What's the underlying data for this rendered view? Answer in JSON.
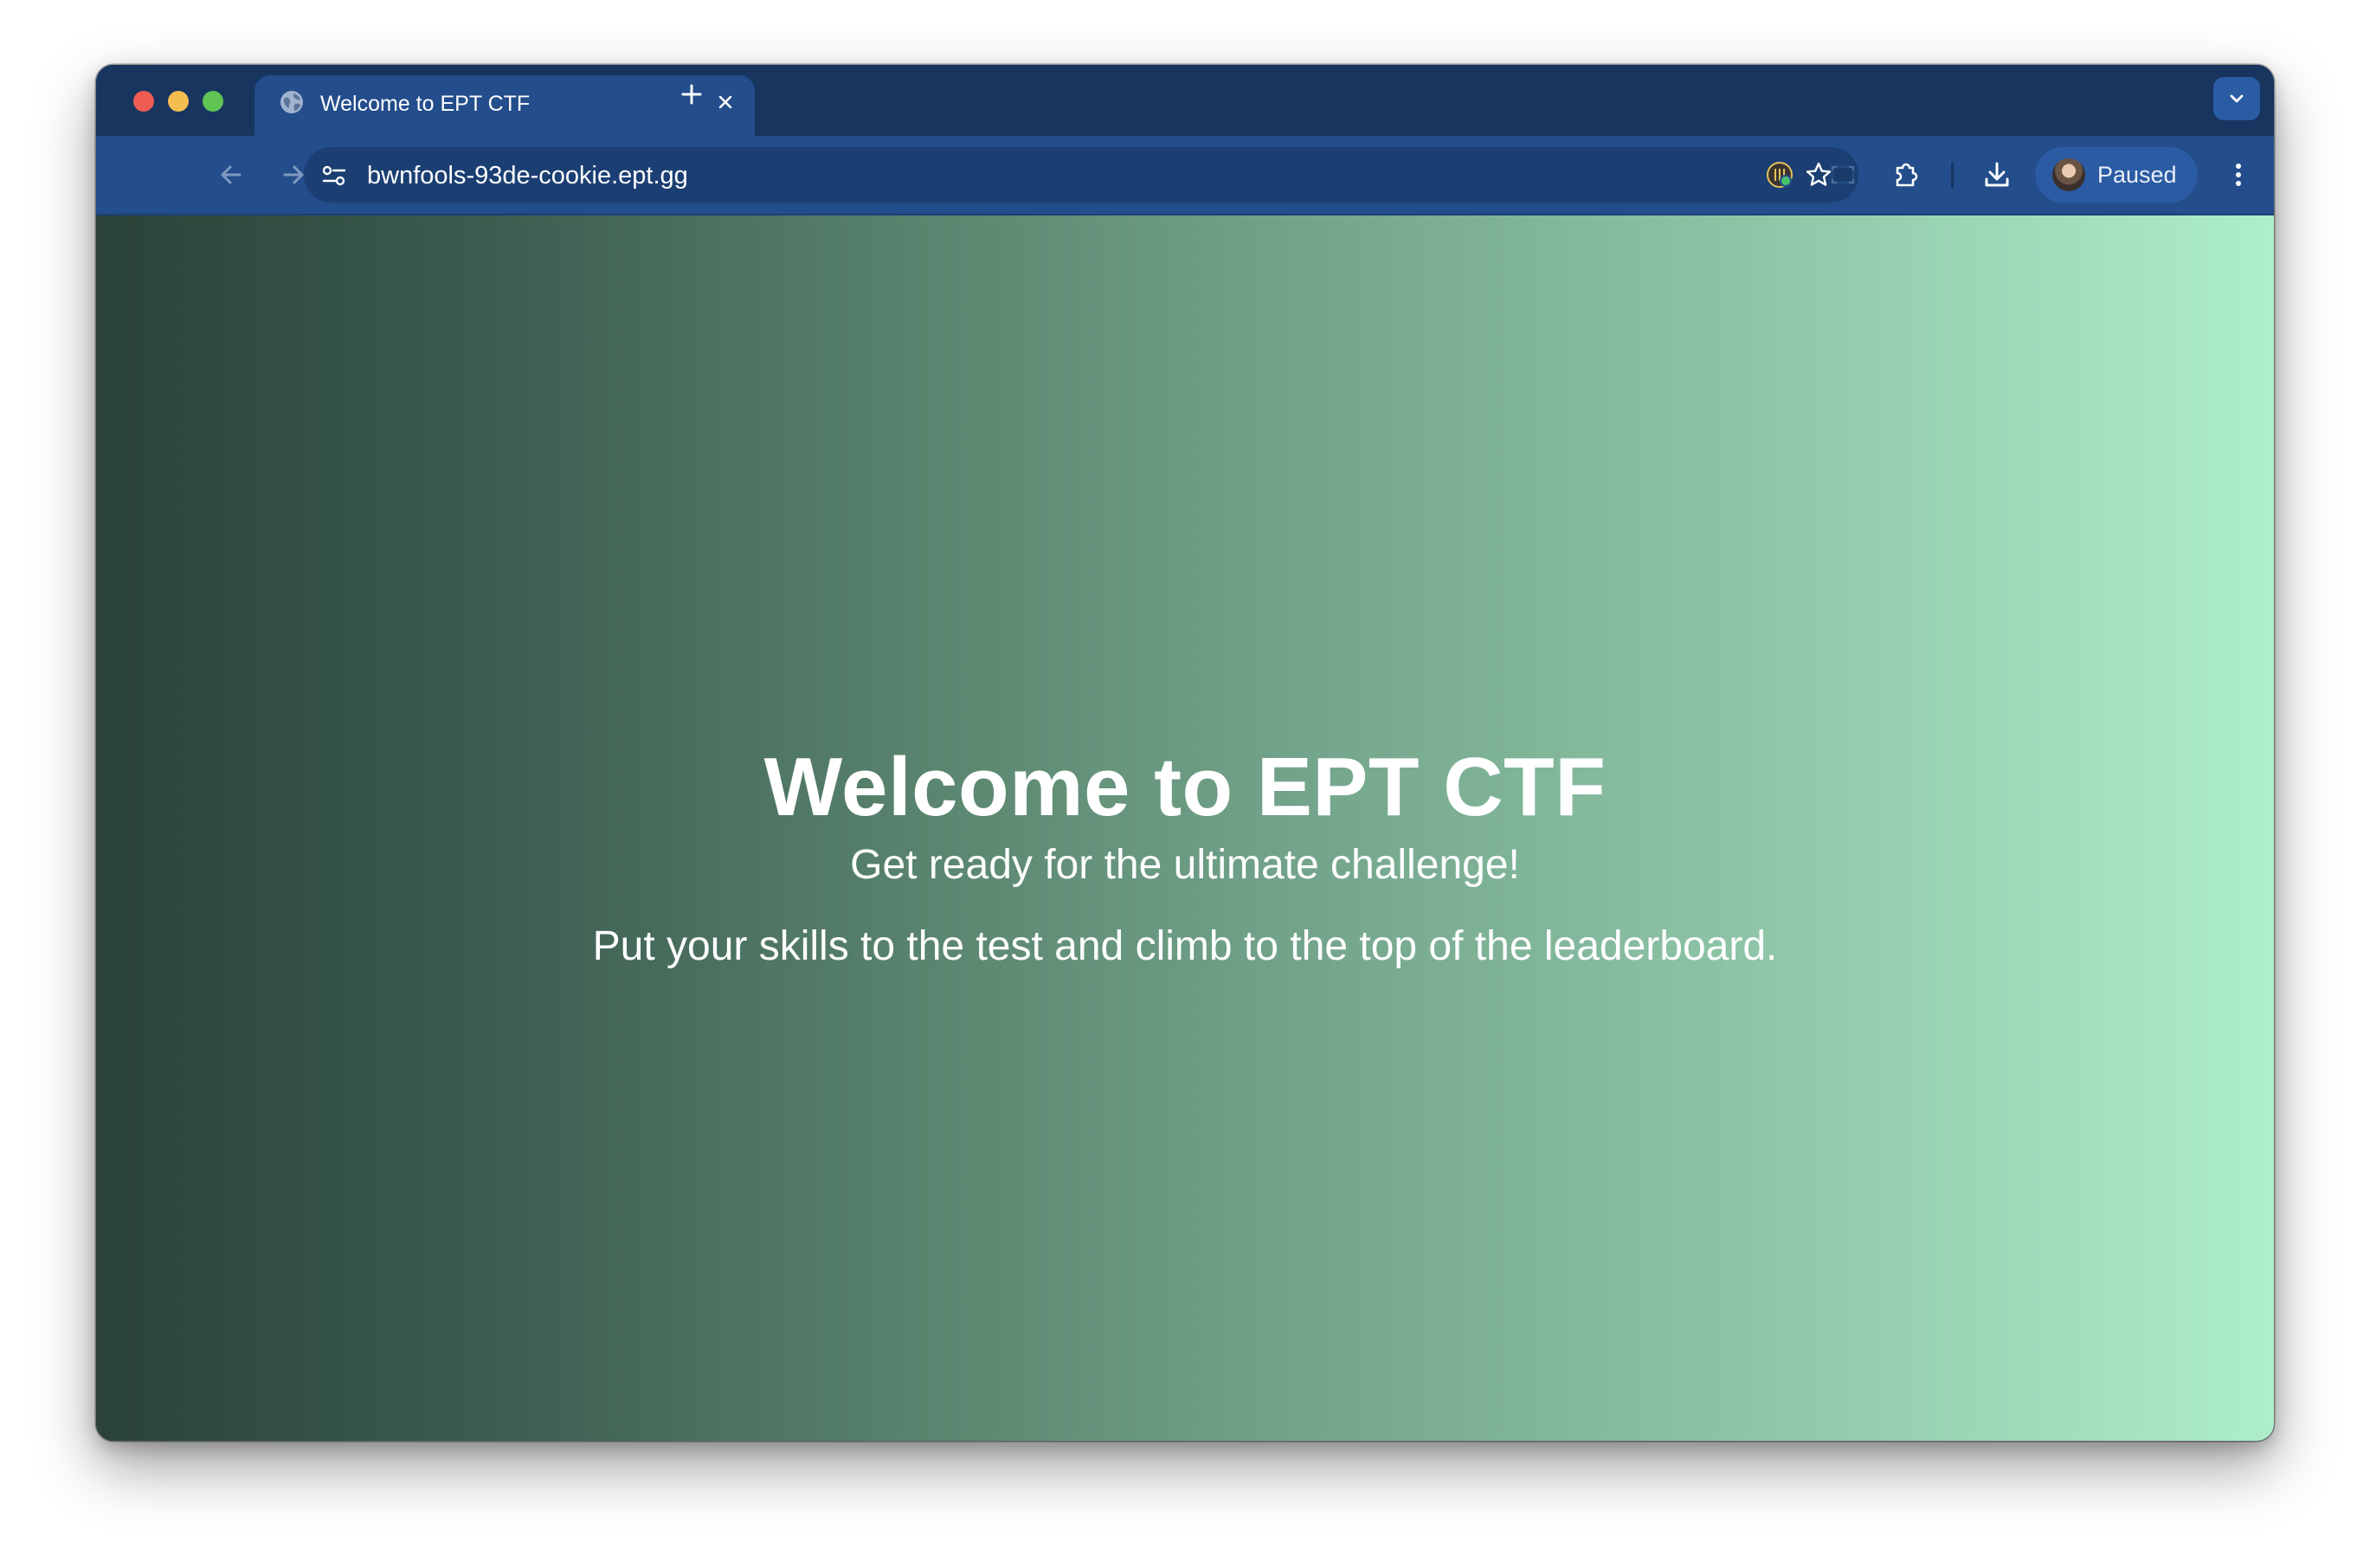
{
  "tab": {
    "title": "Welcome to EPT CTF",
    "favicon": "globe-icon"
  },
  "toolbar": {
    "url": "bwnfools-93de-cookie.ept.gg",
    "profile_label": "Paused"
  },
  "page": {
    "heading": "Welcome to EPT CTF",
    "subheading": "Get ready for the ultimate challenge!",
    "description": "Put your skills to the test and climb to the top of the leaderboard."
  },
  "colors": {
    "tabstrip": "#17355f",
    "toolbar": "#234d8b",
    "gradient_start": "#2a4238",
    "gradient_end": "#aeeeca",
    "text": "#ffffff"
  },
  "icons": [
    "globe-icon",
    "close-icon",
    "plus-icon",
    "chevron-down-icon",
    "back-arrow-icon",
    "forward-arrow-icon",
    "reload-icon",
    "site-settings-icon",
    "star-icon",
    "extension-badge-icon",
    "screen-capture-icon",
    "puzzle-icon",
    "download-icon",
    "kebab-menu-icon"
  ]
}
